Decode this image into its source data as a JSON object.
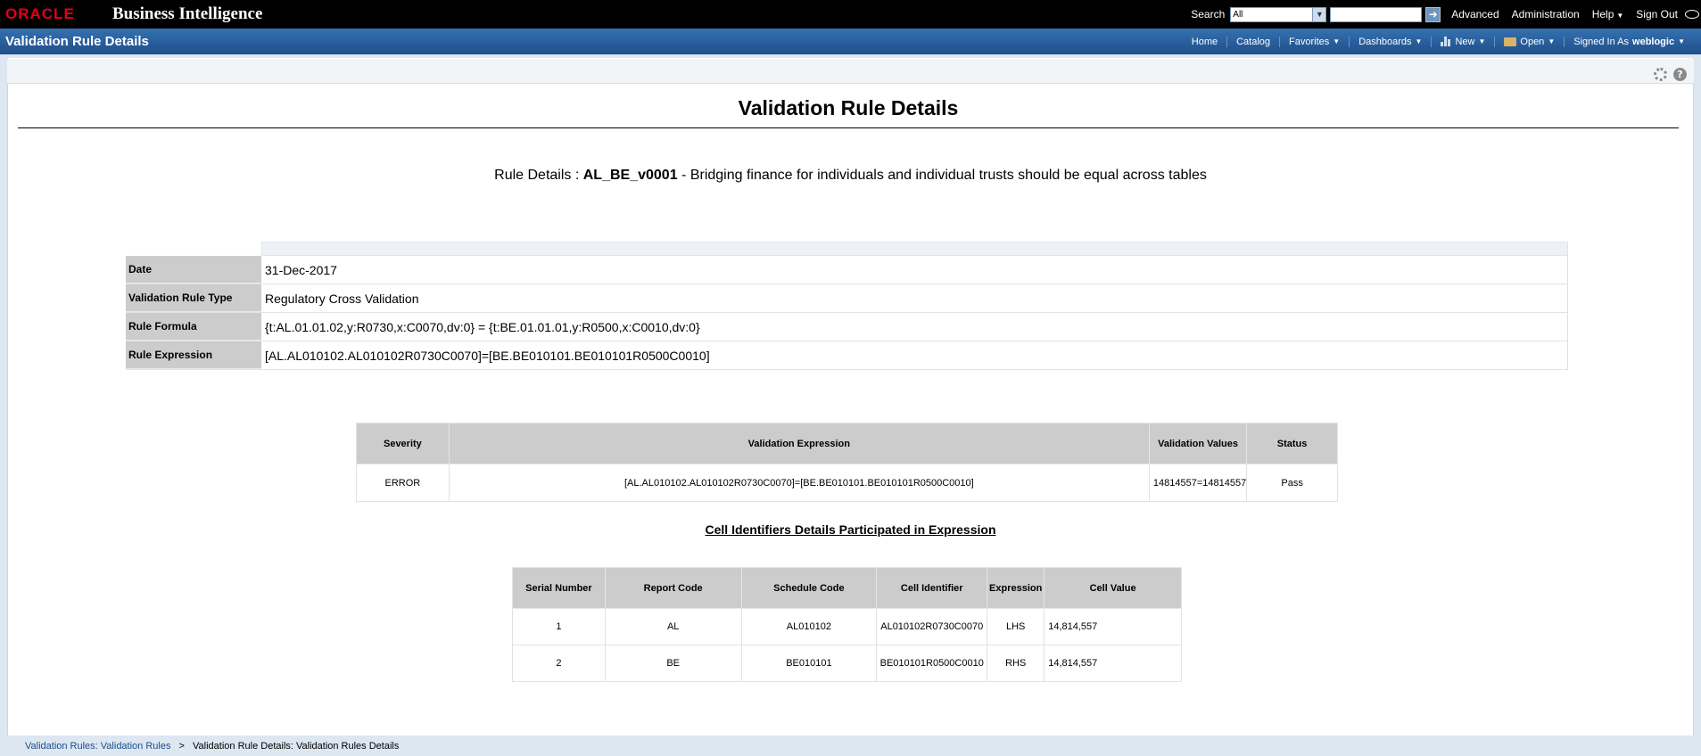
{
  "topbar": {
    "logo": "ORACLE",
    "app_title": "Business Intelligence",
    "search_label": "Search",
    "search_scope": "All",
    "search_placeholder": "",
    "links": [
      "Advanced",
      "Administration",
      "Help",
      "Sign Out"
    ]
  },
  "bluebar": {
    "page_title": "Validation Rule Details",
    "nav": {
      "home": "Home",
      "catalog": "Catalog",
      "favorites": "Favorites",
      "dashboards": "Dashboards",
      "new": "New",
      "open": "Open",
      "signed_in_label": "Signed In As",
      "user": "weblogic"
    }
  },
  "report": {
    "title": "Validation Rule Details",
    "rule_details_label": "Rule Details :",
    "rule_id": "AL_BE_v0001",
    "rule_description": "- Bridging finance for individuals and individual trusts should be equal across tables",
    "info": [
      {
        "key": "Date",
        "value": "31-Dec-2017"
      },
      {
        "key": "Validation Rule Type",
        "value": "Regulatory Cross Validation"
      },
      {
        "key": "Rule Formula",
        "value": "{t:AL.01.01.02,y:R0730,x:C0070,dv:0} = {t:BE.01.01.01,y:R0500,x:C0010,dv:0}"
      },
      {
        "key": "Rule Expression",
        "value": "[AL.AL010102.AL010102R0730C0070]=[BE.BE010101.BE010101R0500C0010]"
      }
    ],
    "severity_table": {
      "headers": [
        "Severity",
        "Validation Expression",
        "Validation Values",
        "Status"
      ],
      "rows": [
        [
          "ERROR",
          "[AL.AL010102.AL010102R0730C0070]=[BE.BE010101.BE010101R0500C0010]",
          "14814557=14814557",
          "Pass"
        ]
      ]
    },
    "cells_heading": "Cell Identifiers Details Participated in Expression",
    "cells_table": {
      "headers": [
        "Serial Number",
        "Report Code",
        "Schedule Code",
        "Cell Identifier",
        "Expression",
        "Cell Value"
      ],
      "rows": [
        [
          "1",
          "AL",
          "AL010102",
          "AL010102R0730C0070",
          "LHS",
          "14,814,557"
        ],
        [
          "2",
          "BE",
          "BE010101",
          "BE010101R0500C0010",
          "RHS",
          "14,814,557"
        ]
      ]
    }
  },
  "footer": {
    "crumb_link": "Validation Rules: Validation Rules",
    "separator": ">",
    "crumb_current": "Validation Rule Details: Validation Rules Details"
  },
  "colors": {
    "top_bar": "#000000",
    "blue_bar": "#2a5c97",
    "oracle_red": "#e0001b",
    "header_gray": "#cccccc"
  }
}
